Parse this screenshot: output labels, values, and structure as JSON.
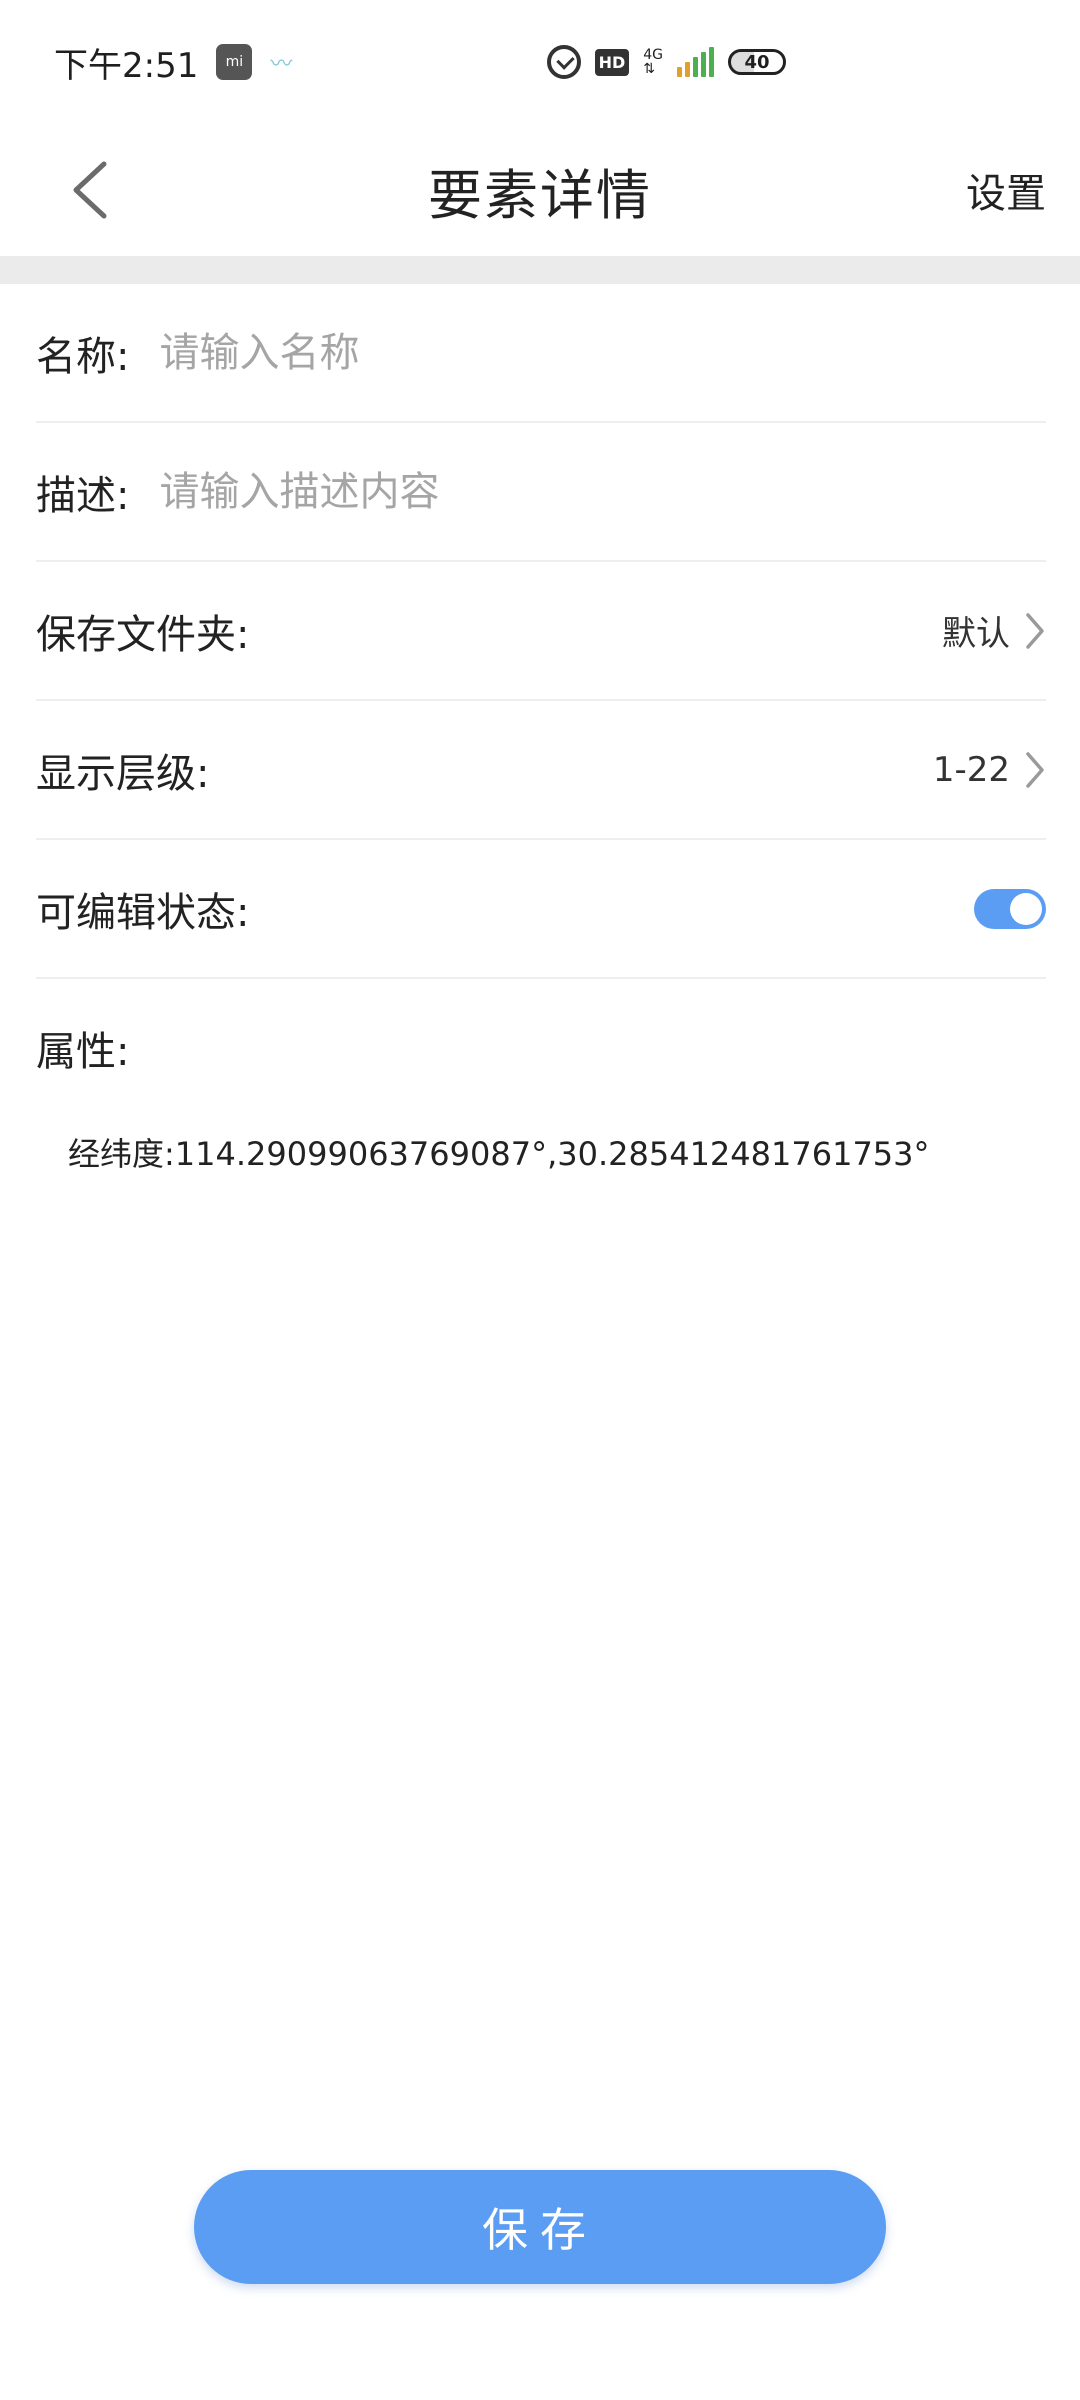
{
  "status_bar": {
    "time": "下午2:51",
    "mi_label": "mi",
    "network": "4G",
    "battery": "40"
  },
  "nav": {
    "title": "要素详情",
    "settings_label": "设置"
  },
  "form": {
    "name_label": "名称:",
    "name_placeholder": "请输入名称",
    "description_label": "描述:",
    "description_placeholder": "请输入描述内容",
    "folder_label": "保存文件夹:",
    "folder_value": "默认",
    "level_label": "显示层级:",
    "level_value": "1-22",
    "editable_label": "可编辑状态:",
    "editable_on": true
  },
  "attributes": {
    "title": "属性:",
    "coords_line": "经纬度:114.29099063769087°,30.285412481761753°"
  },
  "actions": {
    "save_label": "保存"
  },
  "colors": {
    "accent": "#5b9df2"
  }
}
